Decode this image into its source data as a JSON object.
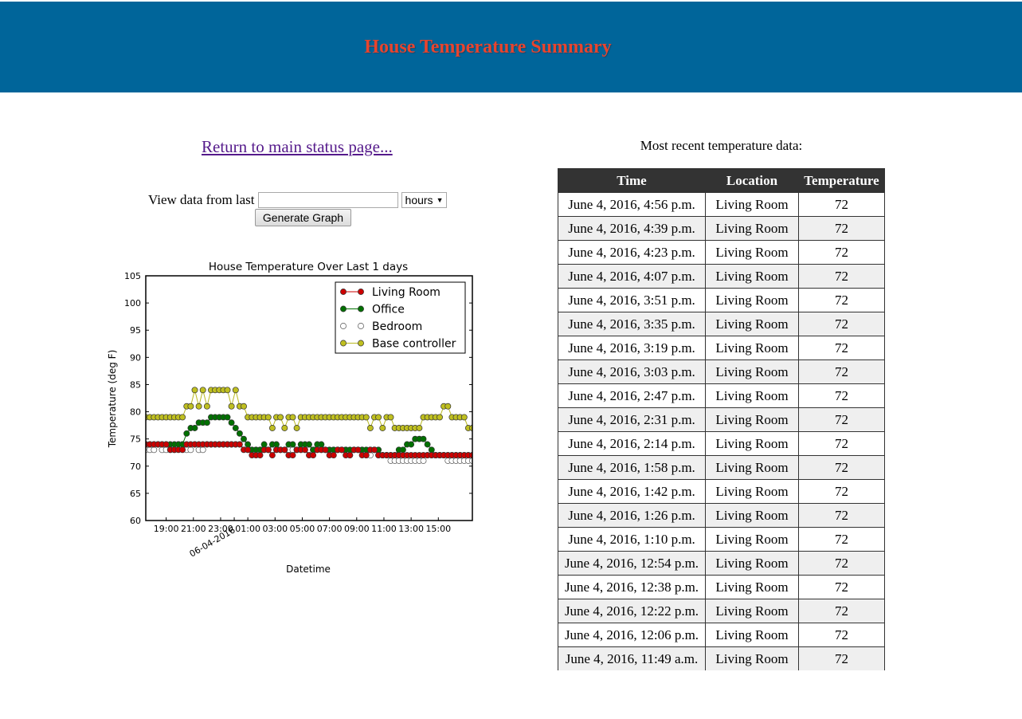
{
  "header": {
    "title": "House Temperature Summary"
  },
  "left": {
    "return_link": "Return to main status page...",
    "view_label": "View data from last",
    "range_value": "",
    "unit_selected": "hours",
    "generate_button": "Generate Graph"
  },
  "right": {
    "heading": "Most recent temperature data:",
    "columns": [
      "Time",
      "Location",
      "Temperature"
    ],
    "rows": [
      [
        "June 4, 2016, 4:56 p.m.",
        "Living Room",
        "72"
      ],
      [
        "June 4, 2016, 4:39 p.m.",
        "Living Room",
        "72"
      ],
      [
        "June 4, 2016, 4:23 p.m.",
        "Living Room",
        "72"
      ],
      [
        "June 4, 2016, 4:07 p.m.",
        "Living Room",
        "72"
      ],
      [
        "June 4, 2016, 3:51 p.m.",
        "Living Room",
        "72"
      ],
      [
        "June 4, 2016, 3:35 p.m.",
        "Living Room",
        "72"
      ],
      [
        "June 4, 2016, 3:19 p.m.",
        "Living Room",
        "72"
      ],
      [
        "June 4, 2016, 3:03 p.m.",
        "Living Room",
        "72"
      ],
      [
        "June 4, 2016, 2:47 p.m.",
        "Living Room",
        "72"
      ],
      [
        "June 4, 2016, 2:31 p.m.",
        "Living Room",
        "72"
      ],
      [
        "June 4, 2016, 2:14 p.m.",
        "Living Room",
        "72"
      ],
      [
        "June 4, 2016, 1:58 p.m.",
        "Living Room",
        "72"
      ],
      [
        "June 4, 2016, 1:42 p.m.",
        "Living Room",
        "72"
      ],
      [
        "June 4, 2016, 1:26 p.m.",
        "Living Room",
        "72"
      ],
      [
        "June 4, 2016, 1:10 p.m.",
        "Living Room",
        "72"
      ],
      [
        "June 4, 2016, 12:54 p.m.",
        "Living Room",
        "72"
      ],
      [
        "June 4, 2016, 12:38 p.m.",
        "Living Room",
        "72"
      ],
      [
        "June 4, 2016, 12:22 p.m.",
        "Living Room",
        "72"
      ],
      [
        "June 4, 2016, 12:06 p.m.",
        "Living Room",
        "72"
      ],
      [
        "June 4, 2016, 11:49 a.m.",
        "Living Room",
        "72"
      ]
    ]
  },
  "chart_data": {
    "type": "line",
    "title": "House Temperature Over Last 1 days",
    "xlabel": "Datetime",
    "ylabel": "Temperature (deg F)",
    "ylim": [
      60,
      105
    ],
    "yticks": [
      60,
      65,
      70,
      75,
      80,
      85,
      90,
      95,
      100,
      105
    ],
    "xlim": [
      17.5,
      41.5
    ],
    "xtick_positions": [
      19,
      21,
      23,
      24,
      25,
      27,
      29,
      31,
      33,
      35,
      37,
      39
    ],
    "xtick_labels": [
      "19:00",
      "21:00",
      "23:00",
      "06-04-2016",
      "01:00",
      "03:00",
      "05:00",
      "07:00",
      "09:00",
      "11:00",
      "13:00",
      "15:00"
    ],
    "rotated_tick": "06-04-2016",
    "legend_position": "upper right",
    "grid": false,
    "series": [
      {
        "name": "Living Room",
        "color": "#cc0000",
        "marker_fill": "#cc0000",
        "x": [
          17.5,
          17.8,
          18.1,
          18.4,
          18.7,
          19.0,
          19.3,
          19.6,
          19.9,
          20.2,
          20.5,
          20.8,
          21.1,
          21.4,
          21.7,
          22.0,
          22.3,
          22.6,
          22.9,
          23.2,
          23.5,
          23.8,
          24.1,
          24.4,
          24.7,
          25.0,
          25.3,
          25.6,
          25.9,
          26.2,
          26.5,
          26.8,
          27.1,
          27.4,
          27.7,
          28.0,
          28.3,
          28.6,
          28.9,
          29.2,
          29.5,
          29.8,
          30.1,
          30.4,
          30.7,
          31.0,
          31.3,
          31.6,
          31.9,
          32.2,
          32.5,
          32.8,
          33.1,
          33.4,
          33.7,
          34.0,
          34.3,
          34.6,
          34.9,
          35.2,
          35.5,
          35.8,
          36.1,
          36.4,
          36.7,
          37.0,
          37.3,
          37.6,
          37.9,
          38.2,
          38.5,
          38.8,
          39.1,
          39.4,
          39.7,
          40.0,
          40.3,
          40.6,
          40.9,
          41.2,
          41.5
        ],
        "y": [
          74,
          74,
          74,
          74,
          74,
          74,
          73,
          73,
          73,
          73,
          74,
          74,
          74,
          74,
          74,
          74,
          74,
          74,
          74,
          74,
          74,
          74,
          74,
          74,
          73,
          73,
          72,
          72,
          72,
          73,
          73,
          72,
          73,
          73,
          73,
          72,
          72,
          73,
          73,
          73,
          72,
          72,
          73,
          73,
          73,
          72,
          72,
          73,
          73,
          72,
          72,
          73,
          73,
          72,
          72,
          73,
          73,
          72,
          72,
          72,
          72,
          72,
          72,
          72,
          72,
          72,
          72,
          72,
          72,
          72,
          72,
          72,
          72,
          72,
          72,
          72,
          72,
          72,
          72,
          72,
          72
        ]
      },
      {
        "name": "Office",
        "color": "#007000",
        "marker_fill": "#007000",
        "x": [
          17.5,
          17.8,
          18.1,
          18.4,
          18.7,
          19.0,
          19.3,
          19.6,
          19.9,
          20.2,
          20.5,
          20.8,
          21.1,
          21.4,
          21.7,
          22.0,
          22.3,
          22.6,
          22.9,
          23.2,
          23.5,
          23.8,
          24.1,
          24.4,
          24.7,
          25.0,
          25.3,
          25.6,
          25.9,
          26.2,
          26.5,
          26.8,
          27.1,
          27.4,
          27.7,
          28.0,
          28.3,
          28.6,
          28.9,
          29.2,
          29.5,
          29.8,
          30.1,
          30.4,
          30.7,
          31.0,
          31.3,
          31.6,
          31.9,
          32.2,
          32.5,
          32.8,
          33.1,
          33.4,
          33.7,
          34.0,
          34.3,
          34.6,
          34.9,
          35.2,
          35.5,
          35.8,
          36.1,
          36.4,
          36.7,
          37.0,
          37.3,
          37.6,
          37.9,
          38.2,
          38.5,
          38.8,
          39.1,
          39.4,
          39.7,
          40.0,
          40.3,
          40.6,
          40.9,
          41.2,
          41.5
        ],
        "y": [
          74,
          74,
          74,
          74,
          74,
          74,
          74,
          74,
          74,
          74,
          76,
          77,
          77,
          78,
          78,
          78,
          79,
          79,
          79,
          79,
          79,
          78,
          77,
          76,
          75,
          74,
          73,
          73,
          73,
          74,
          73,
          74,
          74,
          73,
          73,
          74,
          74,
          73,
          74,
          74,
          74,
          73,
          74,
          74,
          73,
          73,
          73,
          73,
          73,
          73,
          73,
          73,
          73,
          73,
          73,
          73,
          73,
          73,
          72,
          72,
          72,
          72,
          73,
          73,
          74,
          74,
          75,
          75,
          75,
          74,
          73,
          72,
          72,
          72,
          72,
          72,
          72,
          72,
          72,
          72,
          72
        ]
      },
      {
        "name": "Bedroom",
        "color": "#9a9a9a",
        "marker_fill": "#ffffff",
        "x": [
          17.5,
          17.8,
          18.1,
          18.4,
          18.7,
          19.0,
          19.3,
          19.6,
          19.9,
          20.2,
          20.5,
          20.8,
          21.1,
          21.4,
          21.7,
          22.0,
          22.3,
          22.6,
          22.9,
          23.2,
          23.5,
          23.8,
          24.1,
          24.4,
          24.7,
          25.0,
          25.3,
          25.6,
          25.9,
          26.2,
          26.5,
          26.8,
          27.1,
          27.4,
          27.7,
          28.0,
          28.3,
          28.6,
          28.9,
          29.2,
          29.5,
          29.8,
          30.1,
          30.4,
          30.7,
          31.0,
          31.3,
          31.6,
          31.9,
          32.2,
          32.5,
          32.8,
          33.1,
          33.4,
          33.7,
          34.0,
          34.3,
          34.6,
          34.9,
          35.2,
          35.5,
          35.8,
          36.1,
          36.4,
          36.7,
          37.0,
          37.3,
          37.6,
          37.9,
          38.2,
          38.5,
          38.8,
          39.1,
          39.4,
          39.7,
          40.0,
          40.3,
          40.6,
          40.9,
          41.2,
          41.5
        ],
        "y": [
          73,
          73,
          73,
          74,
          73,
          73,
          73,
          73,
          74,
          74,
          73,
          73,
          74,
          73,
          73,
          74,
          74,
          74,
          74,
          74,
          74,
          74,
          74,
          74,
          74,
          73,
          73,
          73,
          73,
          73,
          73,
          73,
          73,
          73,
          73,
          73,
          73,
          73,
          73,
          73,
          73,
          73,
          73,
          73,
          73,
          73,
          73,
          73,
          73,
          73,
          72,
          73,
          73,
          73,
          72,
          72,
          73,
          72,
          72,
          72,
          71,
          71,
          71,
          71,
          71,
          71,
          71,
          71,
          71,
          72,
          72,
          72,
          72,
          72,
          71,
          71,
          71,
          71,
          71,
          71,
          71
        ]
      },
      {
        "name": "Base controller",
        "color": "#b8b820",
        "marker_fill": "#bfbf20",
        "x": [
          17.5,
          17.8,
          18.1,
          18.4,
          18.7,
          19.0,
          19.3,
          19.6,
          19.9,
          20.2,
          20.5,
          20.8,
          21.1,
          21.4,
          21.7,
          22.0,
          22.3,
          22.6,
          22.9,
          23.2,
          23.5,
          23.8,
          24.1,
          24.4,
          24.7,
          25.0,
          25.3,
          25.6,
          25.9,
          26.2,
          26.5,
          26.8,
          27.1,
          27.4,
          27.7,
          28.0,
          28.3,
          28.6,
          28.9,
          29.2,
          29.5,
          29.8,
          30.1,
          30.4,
          30.7,
          31.0,
          31.3,
          31.6,
          31.9,
          32.2,
          32.5,
          32.8,
          33.1,
          33.4,
          33.7,
          34.0,
          34.3,
          34.6,
          34.9,
          35.2,
          35.5,
          35.8,
          36.1,
          36.4,
          36.7,
          37.0,
          37.3,
          37.6,
          37.9,
          38.2,
          38.5,
          38.8,
          39.1,
          39.4,
          39.7,
          40.0,
          40.3,
          40.6,
          40.9,
          41.2,
          41.5
        ],
        "y": [
          79,
          79,
          79,
          79,
          79,
          79,
          79,
          79,
          79,
          79,
          81,
          81,
          84,
          81,
          84,
          81,
          84,
          84,
          84,
          84,
          84,
          81,
          84,
          81,
          81,
          79,
          79,
          79,
          79,
          79,
          79,
          77,
          79,
          79,
          77,
          79,
          79,
          77,
          79,
          79,
          79,
          79,
          79,
          79,
          79,
          79,
          79,
          79,
          79,
          79,
          79,
          79,
          79,
          79,
          79,
          77,
          79,
          79,
          77,
          79,
          79,
          77,
          77,
          77,
          77,
          77,
          77,
          77,
          79,
          79,
          79,
          79,
          79,
          81,
          81,
          79,
          79,
          79,
          79,
          77,
          77
        ]
      }
    ]
  }
}
